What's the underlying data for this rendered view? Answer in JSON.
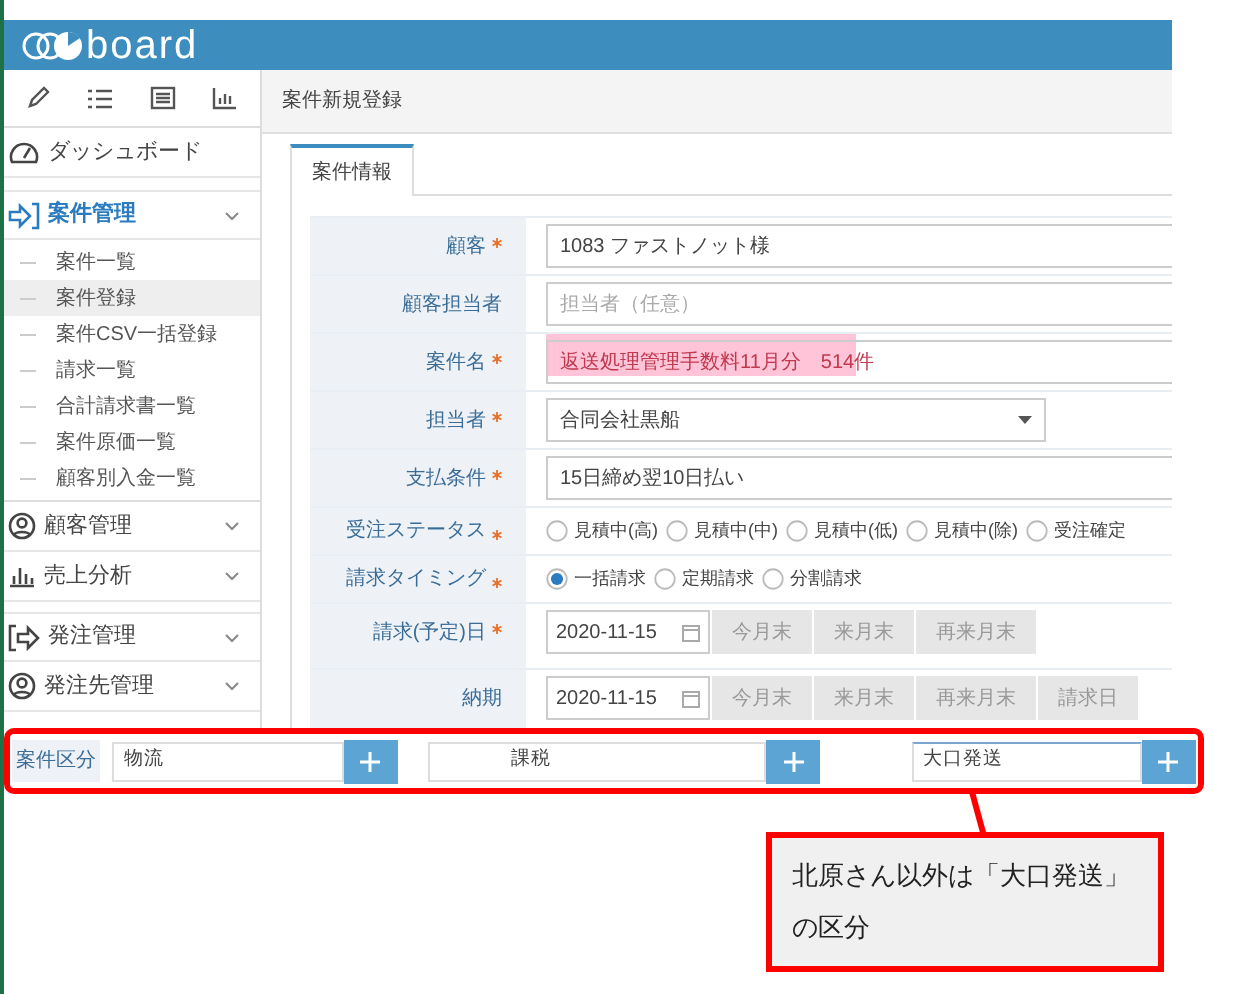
{
  "header": {
    "logo_text": "board"
  },
  "breadcrumb": "案件新規登録",
  "sidebar": {
    "items": [
      {
        "label": "ダッシュボード",
        "kind": "link",
        "selected": false
      },
      {
        "label": "案件管理",
        "kind": "group",
        "selected": true,
        "children": [
          {
            "label": "案件一覧",
            "selected": false
          },
          {
            "label": "案件登録",
            "selected": true
          },
          {
            "label": "案件CSV一括登録",
            "selected": false
          },
          {
            "label": "請求一覧",
            "selected": false
          },
          {
            "label": "合計請求書一覧",
            "selected": false
          },
          {
            "label": "案件原価一覧",
            "selected": false
          },
          {
            "label": "顧客別入金一覧",
            "selected": false
          }
        ]
      },
      {
        "label": "顧客管理",
        "kind": "group",
        "selected": false
      },
      {
        "label": "売上分析",
        "kind": "group",
        "selected": false
      },
      {
        "label": "発注管理",
        "kind": "group",
        "selected": false
      },
      {
        "label": "発注先管理",
        "kind": "group",
        "selected": false
      }
    ]
  },
  "tabs": [
    {
      "label": "案件情報",
      "selected": true
    }
  ],
  "form": {
    "rows": [
      {
        "label": "顧客",
        "required": true,
        "kind": "text",
        "value": "1083 ファストノット様"
      },
      {
        "label": "顧客担当者",
        "required": false,
        "kind": "text",
        "placeholder": "担当者（任意）"
      },
      {
        "label": "案件名",
        "required": true,
        "kind": "text",
        "value": "返送処理管理手数料11月分　514件",
        "highlighted": true
      },
      {
        "label": "担当者",
        "required": true,
        "kind": "select",
        "value": "合同会社黒船"
      },
      {
        "label": "支払条件",
        "required": true,
        "kind": "text",
        "value": "15日締め翌10日払い"
      },
      {
        "label": "受注ステータス",
        "required": true,
        "kind": "radio",
        "options": [
          {
            "label": "見積中(高)",
            "selected": false
          },
          {
            "label": "見積中(中)",
            "selected": false
          },
          {
            "label": "見積中(低)",
            "selected": false
          },
          {
            "label": "見積中(除)",
            "selected": false
          },
          {
            "label": "受注確定",
            "selected": false
          }
        ]
      },
      {
        "label": "請求タイミング",
        "required": true,
        "kind": "radio",
        "options": [
          {
            "label": "一括請求",
            "selected": true
          },
          {
            "label": "定期請求",
            "selected": false
          },
          {
            "label": "分割請求",
            "selected": false
          }
        ]
      },
      {
        "label": "請求(予定)日",
        "required": true,
        "kind": "date",
        "value": "2020-11-15",
        "buttons": [
          "今月末",
          "来月末",
          "再来月末"
        ]
      },
      {
        "label": "納期",
        "required": false,
        "kind": "date",
        "value": "2020-11-15",
        "buttons": [
          "今月末",
          "来月末",
          "再来月末",
          "請求日"
        ]
      }
    ]
  },
  "category_strip": {
    "label": "案件区分",
    "fields": [
      {
        "value": "物流"
      },
      {
        "value": "課税"
      },
      {
        "value": "大口発送"
      }
    ]
  },
  "callout": {
    "text": "北原さん以外は「大口発送」の区分"
  }
}
